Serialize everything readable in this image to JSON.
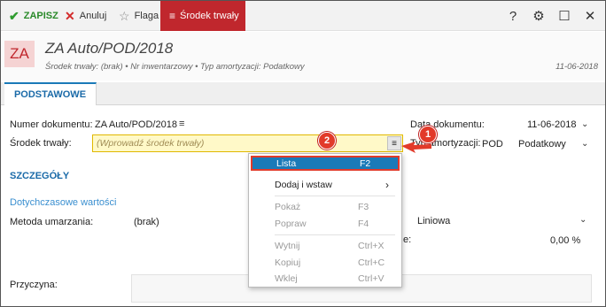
{
  "toolbar": {
    "save_label": "ZAPISZ",
    "cancel_label": "Anuluj",
    "flag_label": "Flaga",
    "active_label": "Środek trwały",
    "help_glyph": "?",
    "settings_glyph": "⚙",
    "maximize_glyph": "☐",
    "close_glyph": "✕"
  },
  "header": {
    "badge": "ZA",
    "title": "ZA Auto/POD/2018",
    "subtitle": "Środek trwały: (brak)  •  Nr inwentarzowy  •  Typ amortyzacji: Podatkowy",
    "date": "11-06-2018"
  },
  "tabs": [
    {
      "label": "PODSTAWOWE"
    }
  ],
  "form": {
    "doc_number_label": "Numer dokumentu:",
    "doc_number_value": "ZA Auto/POD/2018",
    "fixed_asset_label": "Środek trwały:",
    "fixed_asset_placeholder": "(Wprowadź środek trwały)",
    "doc_date_label": "Data dokumentu:",
    "doc_date_value": "11-06-2018",
    "depr_type_label": "Typ amortyzacji:",
    "depr_type_code": "POD",
    "depr_type_value": "Podatkowy",
    "section_details": "SZCZEGÓŁY",
    "previous_values": "Dotychczasowe wartości",
    "method_label": "Metoda umarzania:",
    "method_value": "(brak)",
    "method_new_value": "Liniowa",
    "rate_value": "0,00 %",
    "reason_label": "Przyczyna:"
  },
  "markers": {
    "one": "1",
    "two": "2"
  },
  "menu": {
    "items": [
      {
        "label": "Lista",
        "shortcut": "F2",
        "state": "selected"
      },
      {
        "label": "Dodaj i wstaw",
        "shortcut": "",
        "state": "submenu"
      },
      {
        "label": "Pokaż",
        "shortcut": "F3",
        "state": "disabled"
      },
      {
        "label": "Popraw",
        "shortcut": "F4",
        "state": "disabled"
      },
      {
        "label": "Wytnij",
        "shortcut": "Ctrl+X",
        "state": "disabled"
      },
      {
        "label": "Kopiuj",
        "shortcut": "Ctrl+C",
        "state": "disabled"
      },
      {
        "label": "Wklej",
        "shortcut": "Ctrl+V",
        "state": "disabled"
      }
    ]
  },
  "colors": {
    "accent_red": "#c0272d",
    "accent_blue": "#1a7ab8",
    "marker_red": "#e23a2a",
    "input_yellow": "#fff9c8"
  }
}
